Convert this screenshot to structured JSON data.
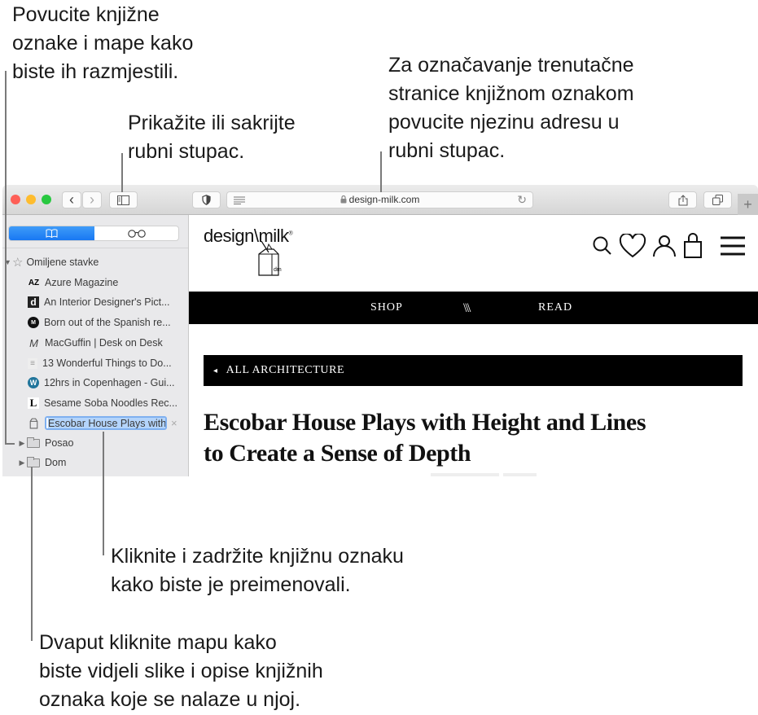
{
  "callouts": {
    "drag": [
      "Povucite knjižne",
      "oznake i mape kako",
      "biste ih razmjestili."
    ],
    "sidebar_toggle": [
      "Prikažite ili sakrijte",
      "rubni stupac."
    ],
    "add_bookmark": [
      "Za označavanje trenutačne",
      "stranice knjižnom oznakom",
      "povucite njezinu adresu u",
      "rubni stupac."
    ],
    "rename": [
      "Kliknite i zadržite knjižnu oznaku",
      "kako biste je preimenovali."
    ],
    "folder": [
      "Dvaput kliknite mapu kako",
      "biste vidjeli slike i opise knjižnih",
      "oznaka koje se nalaze u njoj."
    ]
  },
  "toolbar": {
    "traffic_colors": [
      "#fe5f57",
      "#febc2e",
      "#28c840"
    ],
    "back_icon": "‹",
    "forward_icon": "›",
    "address": "design-milk.com",
    "lock_icon": "🔒",
    "reload_icon": "↻",
    "new_tab_icon": "+"
  },
  "sidebar": {
    "tabs": [
      {
        "name": "bookmarks",
        "icon": "book-icon",
        "active": true
      },
      {
        "name": "reading-list",
        "icon": "glasses-icon",
        "active": false
      }
    ],
    "favorites_label": "Omiljene stavke",
    "items": [
      {
        "label": "Azure Magazine",
        "favicon": "AZ"
      },
      {
        "label": "An Interior Designer's Pict...",
        "favicon": "d"
      },
      {
        "label": "Born out of the Spanish re...",
        "favicon": "M"
      },
      {
        "label": "MacGuffin | Desk on Desk",
        "favicon": "M"
      },
      {
        "label": "13 Wonderful Things to Do...",
        "favicon": "≡"
      },
      {
        "label": "12hrs in Copenhagen - Gui...",
        "favicon": "W"
      },
      {
        "label": "Sesame Soba Noodles Rec...",
        "favicon": "L"
      }
    ],
    "editing_item": "Escobar House Plays with Height and Lines",
    "clear_icon": "×",
    "folders": [
      "Posao",
      "Dom"
    ]
  },
  "web": {
    "logo": "design\\milk",
    "logo_mark": "®",
    "carton_label": "dm",
    "nav": {
      "shop": "SHOP",
      "divider": "\\\\\\",
      "read": "READ"
    },
    "category": "ALL ARCHITECTURE",
    "category_arrow": "◂",
    "headline": [
      "Escobar House Plays with Height and Lines",
      "to Create a Sense of Depth"
    ]
  }
}
